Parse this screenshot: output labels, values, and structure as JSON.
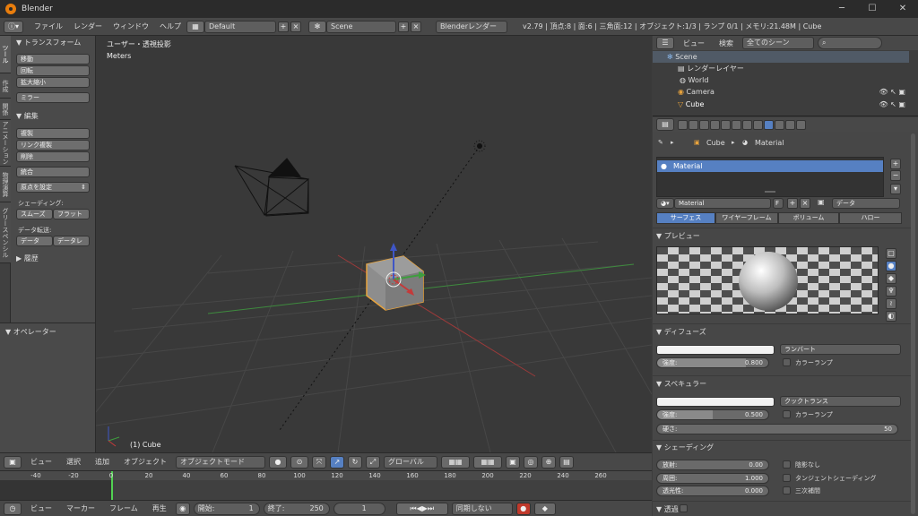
{
  "window": {
    "title": "Blender",
    "minimize": "─",
    "maximize": "☐",
    "close": "✕"
  },
  "infobar": {
    "menus": [
      "ファイル",
      "レンダー",
      "ウィンドウ",
      "ヘルプ"
    ],
    "layout": "Default",
    "scene": "Scene",
    "engine": "Blenderレンダー",
    "stats": "v2.79 | 頂点:8 | 面:6 | 三角面:12 | オブジェクト:1/3 | ランプ 0/1 | メモリ:21.48M | Cube"
  },
  "tabs": [
    "ツール",
    "作成",
    "関係",
    "アニメーション",
    "物理演算",
    "グリースペンシル"
  ],
  "toolshelf": {
    "transform_header": "▼ トランスフォーム",
    "move": "移動",
    "rotate": "回転",
    "scale": "拡大縮小",
    "mirror": "ミラー",
    "edit_header": "▼ 編集",
    "duplicate": "複製",
    "linked_duplicate": "リンク複製",
    "delete": "削除",
    "join": "統合",
    "set_origin": "原点を設定",
    "shading_label": "シェーディング:",
    "smooth": "スムーズ",
    "flat": "フラット",
    "data_transfer_label": "データ転送:",
    "data": "データ",
    "data_layout": "データレ",
    "history_header": "▶ 履歴",
    "operator_header": "▼ オペレーター"
  },
  "viewport": {
    "view_name": "ユーザー・透視投影",
    "units": "Meters",
    "object_label": "(1) Cube"
  },
  "view3d_header": {
    "menus": [
      "ビュー",
      "選択",
      "追加",
      "オブジェクト"
    ],
    "mode": "オブジェクトモード",
    "orientation": "グローバル"
  },
  "timeline": {
    "ticks": [
      "-40",
      "-20",
      "0",
      "20",
      "40",
      "60",
      "80",
      "100",
      "120",
      "140",
      "160",
      "180",
      "200",
      "220",
      "240",
      "260"
    ],
    "menus": [
      "ビュー",
      "マーカー",
      "フレーム",
      "再生"
    ],
    "start_label": "開始:",
    "start": "1",
    "end_label": "終了:",
    "end": "250",
    "current": "1",
    "sync": "同期しない"
  },
  "outliner": {
    "menus": [
      "ビュー",
      "検索"
    ],
    "filter": "全てのシーン",
    "rows": [
      "Scene",
      "レンダーレイヤー",
      "World",
      "Camera",
      "Cube"
    ]
  },
  "properties": {
    "breadcrumb_object": "Cube",
    "breadcrumb_material": "Material",
    "slot_name": "Material",
    "material_name": "Material",
    "fake_user": "F",
    "link": "データ",
    "type_tabs": [
      "サーフェス",
      "ワイヤーフレーム",
      "ボリューム",
      "ハロー"
    ],
    "preview_header": "▼ プレビュー",
    "diffuse_header": "▼ ディフューズ",
    "diffuse_shader": "ランバート",
    "diffuse_intensity_label": "強度:",
    "diffuse_intensity": "0.800",
    "diffuse_intensity_fraction": 0.8,
    "ramp_label": "カラーランプ",
    "specular_header": "▼ スペキュラー",
    "specular_shader": "クックトランス",
    "specular_intensity_label": "強度:",
    "specular_intensity": "0.500",
    "specular_intensity_fraction": 0.5,
    "specular_ramp_label": "カラーランプ",
    "hardness_label": "硬さ:",
    "hardness": "50",
    "shading_header": "▼ シェーディング",
    "emit_label": "放射:",
    "emit": "0.00",
    "ambient_label": "周囲:",
    "ambient": "1.000",
    "translucency_label": "透光性:",
    "translucency": "0.000",
    "shadeless": "陰影なし",
    "tangent": "タンジェントシェーディング",
    "cubic": "三次補間",
    "transparency_header": "▼ 透過"
  },
  "colors": {
    "accent": "#5680c2",
    "cube_outline": "#e8a33c",
    "x_axis": "#9b3a3a",
    "y_axis": "#3e8b3e"
  }
}
